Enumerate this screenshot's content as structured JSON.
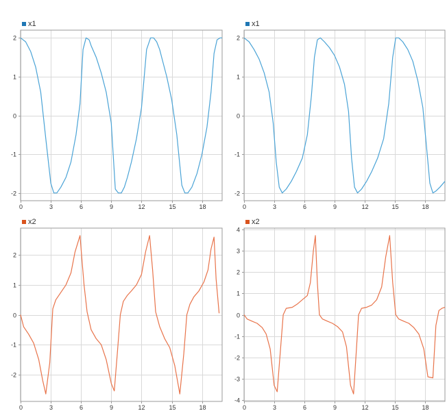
{
  "colors": {
    "x1": "#1f77b4",
    "x1_line": "#4aa3d6",
    "x2": "#d9531e",
    "x2_line": "#e8734a",
    "grid": "#d9d9d9",
    "frame": "#9a9a9a"
  },
  "chart_data": [
    {
      "type": "line",
      "title": "",
      "grid": true,
      "legend": "top-left",
      "xlim": [
        0,
        20
      ],
      "ylim": [
        -2.2,
        2.2
      ],
      "xticks": [
        0,
        3,
        6,
        9,
        12,
        15,
        18
      ],
      "yticks": [
        -2,
        -1,
        0,
        1,
        2
      ],
      "series": [
        {
          "name": "x1",
          "color": "#4aa3d6",
          "x": [
            0,
            0.5,
            1,
            1.5,
            2,
            2.5,
            3,
            3.3,
            3.6,
            4,
            4.5,
            5,
            5.5,
            5.9,
            6.2,
            6.5,
            6.8,
            7,
            7.5,
            8,
            8.5,
            9,
            9.4,
            9.7,
            10,
            10.3,
            10.6,
            11,
            11.5,
            12,
            12.5,
            12.9,
            13.2,
            13.5,
            13.8,
            14,
            14.5,
            15,
            15.5,
            16,
            16.3,
            16.6,
            17,
            17.5,
            18,
            18.5,
            18.9,
            19.2,
            19.5,
            19.8,
            20
          ],
          "y": [
            2,
            1.9,
            1.65,
            1.25,
            0.6,
            -0.6,
            -1.75,
            -2,
            -2,
            -1.85,
            -1.6,
            -1.2,
            -0.5,
            0.3,
            1.7,
            2,
            1.95,
            1.8,
            1.5,
            1.1,
            0.6,
            -0.2,
            -1.9,
            -2,
            -2,
            -1.85,
            -1.6,
            -1.2,
            -0.6,
            0.2,
            1.7,
            2,
            2,
            1.9,
            1.7,
            1.5,
            1,
            0.4,
            -0.5,
            -1.8,
            -2,
            -2,
            -1.85,
            -1.5,
            -1,
            -0.3,
            0.6,
            1.6,
            1.95,
            2,
            2
          ]
        }
      ]
    },
    {
      "type": "line",
      "title": "",
      "grid": true,
      "legend": "top-left",
      "xlim": [
        0,
        20
      ],
      "ylim": [
        -2.2,
        2.2
      ],
      "xticks": [
        0,
        3,
        6,
        9,
        12,
        15,
        18
      ],
      "yticks": [
        -2,
        -1,
        0,
        1,
        2
      ],
      "series": [
        {
          "name": "x1",
          "color": "#4aa3d6",
          "x": [
            0,
            0.5,
            1,
            1.5,
            2,
            2.5,
            2.9,
            3.2,
            3.5,
            3.8,
            4.2,
            4.7,
            5.2,
            5.8,
            6.3,
            6.7,
            7,
            7.3,
            7.6,
            8,
            8.5,
            9,
            9.5,
            10,
            10.4,
            10.7,
            11,
            11.3,
            11.7,
            12.2,
            12.7,
            13.3,
            13.9,
            14.4,
            14.8,
            15.1,
            15.4,
            15.8,
            16.3,
            16.8,
            17.3,
            17.8,
            18.2,
            18.5,
            18.8,
            19.1,
            19.5,
            20
          ],
          "y": [
            2,
            1.9,
            1.7,
            1.45,
            1.1,
            0.6,
            -0.2,
            -1.2,
            -1.85,
            -2,
            -1.9,
            -1.7,
            -1.45,
            -1.1,
            -0.5,
            0.5,
            1.5,
            1.95,
            2,
            1.9,
            1.75,
            1.55,
            1.25,
            0.8,
            0.1,
            -1.1,
            -1.85,
            -2,
            -1.9,
            -1.7,
            -1.45,
            -1.1,
            -0.6,
            0.3,
            1.5,
            2,
            2,
            1.9,
            1.7,
            1.4,
            0.9,
            0.2,
            -0.9,
            -1.75,
            -2,
            -1.95,
            -1.85,
            -1.7
          ]
        }
      ]
    },
    {
      "type": "line",
      "title": "",
      "grid": true,
      "legend": "top-left",
      "xlim": [
        0,
        20
      ],
      "ylim": [
        -2.9,
        2.9
      ],
      "xticks": [
        0,
        3,
        6,
        9,
        12,
        15,
        18
      ],
      "yticks": [
        -2,
        -1,
        0,
        1,
        2
      ],
      "series": [
        {
          "name": "x2",
          "color": "#e8734a",
          "x": [
            0,
            0.3,
            0.8,
            1.3,
            1.8,
            2.2,
            2.5,
            2.9,
            3.2,
            3.5,
            4,
            4.5,
            5,
            5.4,
            5.9,
            6.1,
            6.3,
            6.6,
            7,
            7.5,
            8,
            8.5,
            9,
            9.3,
            9.6,
            9.9,
            10.2,
            10.6,
            11,
            11.5,
            12,
            12.4,
            12.8,
            13.1,
            13.4,
            13.8,
            14.3,
            14.8,
            15.3,
            15.8,
            16.2,
            16.5,
            16.8,
            17.2,
            17.7,
            18.2,
            18.6,
            18.9,
            19.2,
            19.4,
            19.7
          ],
          "y": [
            0,
            -0.4,
            -0.65,
            -0.95,
            -1.5,
            -2.2,
            -2.65,
            -1.6,
            0.2,
            0.5,
            0.75,
            1,
            1.4,
            2.1,
            2.65,
            1.8,
            1,
            0.1,
            -0.5,
            -0.8,
            -1,
            -1.5,
            -2.3,
            -2.55,
            -1.3,
            0,
            0.45,
            0.65,
            0.8,
            1,
            1.35,
            2.1,
            2.65,
            1.5,
            0.1,
            -0.4,
            -0.8,
            -1.1,
            -1.7,
            -2.65,
            -1.3,
            0,
            0.35,
            0.6,
            0.8,
            1.1,
            1.5,
            2.2,
            2.6,
            1.2,
            0.05
          ]
        }
      ]
    },
    {
      "type": "line",
      "title": "",
      "grid": true,
      "legend": "top-left",
      "xlim": [
        0,
        20
      ],
      "ylim": [
        -4.05,
        4.05
      ],
      "xticks": [
        0,
        3,
        6,
        9,
        12,
        15,
        18
      ],
      "yticks": [
        -4,
        -3,
        -2,
        -1,
        0,
        1,
        2,
        3,
        4
      ],
      "series": [
        {
          "name": "x2",
          "color": "#e8734a",
          "x": [
            0,
            0.3,
            0.8,
            1.3,
            1.8,
            2.2,
            2.6,
            3,
            3.3,
            3.6,
            3.9,
            4.2,
            4.8,
            5.3,
            5.8,
            6.3,
            6.6,
            6.9,
            7.1,
            7.3,
            7.5,
            7.8,
            8.3,
            8.8,
            9.3,
            9.8,
            10.2,
            10.6,
            10.9,
            11.2,
            11.4,
            11.7,
            12.2,
            12.7,
            13.2,
            13.7,
            14.1,
            14.5,
            14.8,
            15.1,
            15.4,
            15.9,
            16.4,
            16.9,
            17.4,
            17.9,
            18.3,
            18.8,
            19.1,
            19.4,
            19.7,
            20
          ],
          "y": [
            0,
            -0.2,
            -0.3,
            -0.4,
            -0.6,
            -0.9,
            -1.6,
            -3.3,
            -3.6,
            -1.8,
            0,
            0.3,
            0.35,
            0.5,
            0.7,
            0.9,
            1.5,
            3,
            3.7,
            1.5,
            0,
            -0.2,
            -0.3,
            -0.4,
            -0.55,
            -0.8,
            -1.5,
            -3.3,
            -3.7,
            -1.5,
            0,
            0.3,
            0.35,
            0.45,
            0.7,
            1.3,
            2.7,
            3.7,
            1.5,
            0,
            -0.2,
            -0.3,
            -0.4,
            -0.6,
            -0.9,
            -1.6,
            -2.9,
            -2.95,
            -0.5,
            0.2,
            0.3,
            0.35
          ]
        }
      ]
    }
  ]
}
